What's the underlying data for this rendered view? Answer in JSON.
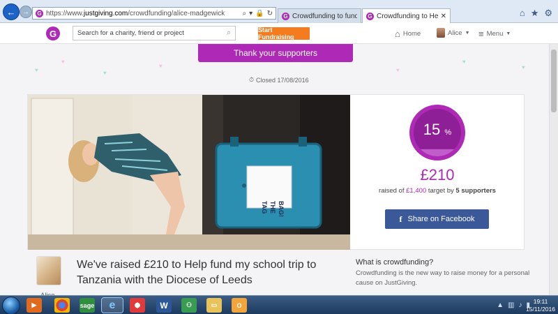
{
  "browser": {
    "url_prefix": "https://www.",
    "url_domain": "justgiving.com",
    "url_path": "/crowdfunding/alice-madgewick",
    "tabs": [
      {
        "label": "Crowdfunding to fund a trip to...",
        "active": false
      },
      {
        "label": "Crowdfunding to Help fund...",
        "active": true
      }
    ]
  },
  "header": {
    "logo_letter": "G",
    "search_placeholder": "Search for a charity, friend or project",
    "start_fundraising": "Start Fundraising",
    "home": "Home",
    "user": "Alice",
    "menu": "Menu"
  },
  "main": {
    "thank_button": "Thank your supporters",
    "closed_text": "Closed 17/08/2016",
    "photo_sign": [
      "TAG",
      "THE",
      "BAG!"
    ],
    "percent": "15",
    "percent_sign": "%",
    "progress_fraction": 0.15,
    "raised_amount": "£210",
    "target_prefix": "raised of",
    "target_amount": "£1,400",
    "target_mid": "target by",
    "supporters": "5 supporters",
    "facebook_button": "Share on Facebook",
    "owner_name": "Alice",
    "campaign_title": "We've raised £210 to Help fund my school trip to Tanzania with the Diocese of Leeds",
    "what_title": "What is crowdfunding?",
    "what_text": "Crowdfunding is the new way to raise money for a personal cause on JustGiving."
  },
  "taskbar": {
    "apps": [
      "media-player",
      "chrome",
      "sage",
      "internet-explorer",
      "paint",
      "word",
      "network",
      "file-explorer",
      "outlook"
    ],
    "time": "19:11",
    "date": "15/11/2016"
  },
  "colors": {
    "brand": "#ad29b6",
    "orange": "#f47c1f",
    "facebook": "#3b5998"
  }
}
